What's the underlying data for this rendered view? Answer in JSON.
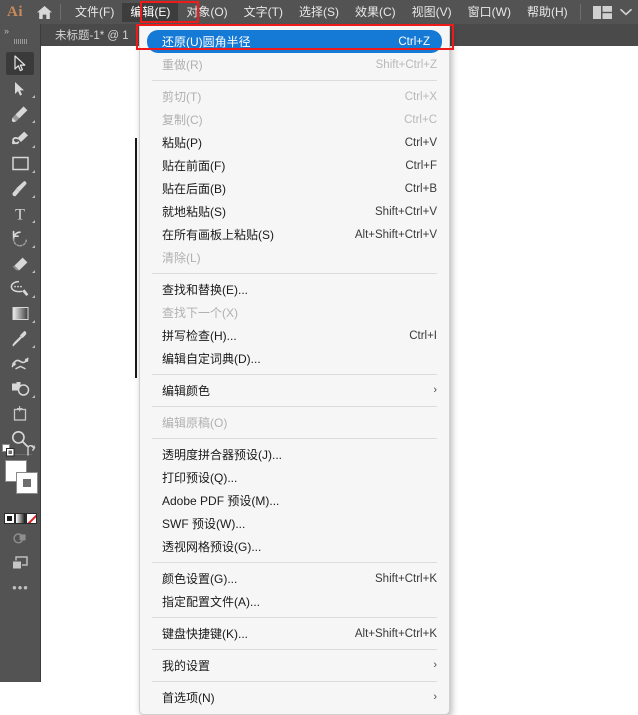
{
  "app": {
    "logo_text": "Ai",
    "home_icon": "home-icon"
  },
  "menubar": {
    "items": [
      {
        "label": "文件(F)",
        "name": "file",
        "active": false
      },
      {
        "label": "编辑(E)",
        "name": "edit",
        "active": true
      },
      {
        "label": "对象(O)",
        "name": "object",
        "active": false
      },
      {
        "label": "文字(T)",
        "name": "type",
        "active": false
      },
      {
        "label": "选择(S)",
        "name": "select",
        "active": false
      },
      {
        "label": "效果(C)",
        "name": "effect",
        "active": false
      },
      {
        "label": "视图(V)",
        "name": "view",
        "active": false
      },
      {
        "label": "窗口(W)",
        "name": "window",
        "active": false
      },
      {
        "label": "帮助(H)",
        "name": "help",
        "active": false
      }
    ],
    "workspace_icon": "workspace-switcher-icon",
    "chevron_icon": "chevron-down-icon"
  },
  "document_tab": {
    "title": "未标题-1* @ 1"
  },
  "toolbar": {
    "grip_label": "»",
    "tools": [
      {
        "name": "selection-tool",
        "selected": true,
        "corner": false
      },
      {
        "name": "direct-selection-tool",
        "selected": false,
        "corner": true
      },
      {
        "name": "pen-tool",
        "selected": false,
        "corner": true
      },
      {
        "name": "curvature-tool",
        "selected": false,
        "corner": true
      },
      {
        "name": "rectangle-tool",
        "selected": false,
        "corner": true
      },
      {
        "name": "paintbrush-tool",
        "selected": false,
        "corner": true
      },
      {
        "name": "type-tool",
        "selected": false,
        "corner": true
      },
      {
        "name": "rotate-tool",
        "selected": false,
        "corner": true
      },
      {
        "name": "eraser-tool",
        "selected": false,
        "corner": true
      },
      {
        "name": "shaper-tool",
        "selected": false,
        "corner": true
      },
      {
        "name": "gradient-tool",
        "selected": false,
        "corner": true
      },
      {
        "name": "eyedropper-tool",
        "selected": false,
        "corner": true
      },
      {
        "name": "blend-tool",
        "selected": false,
        "corner": false
      },
      {
        "name": "shape-builder-tool",
        "selected": false,
        "corner": true
      },
      {
        "name": "artboard-tool",
        "selected": false,
        "corner": false
      },
      {
        "name": "zoom-tool",
        "selected": false,
        "corner": true
      }
    ],
    "fill_color": "#ffffff",
    "stroke_color": "#ffffff",
    "color_modes": [
      "color-mode",
      "gradient-mode",
      "none-mode"
    ],
    "draw_mode_icon": "draw-normal-icon",
    "screen_mode_icon": "screen-mode-icon",
    "more_tools_label": "•••"
  },
  "edit_menu": {
    "items": [
      {
        "type": "item",
        "label": "还原(U)圆角半径",
        "accel": "Ctrl+Z",
        "state": "highlight",
        "name": "undo"
      },
      {
        "type": "item",
        "label": "重做(R)",
        "accel": "Shift+Ctrl+Z",
        "state": "disabled",
        "name": "redo"
      },
      {
        "type": "sep"
      },
      {
        "type": "item",
        "label": "剪切(T)",
        "accel": "Ctrl+X",
        "state": "disabled",
        "name": "cut"
      },
      {
        "type": "item",
        "label": "复制(C)",
        "accel": "Ctrl+C",
        "state": "disabled",
        "name": "copy"
      },
      {
        "type": "item",
        "label": "粘贴(P)",
        "accel": "Ctrl+V",
        "state": "normal",
        "name": "paste"
      },
      {
        "type": "item",
        "label": "贴在前面(F)",
        "accel": "Ctrl+F",
        "state": "normal",
        "name": "paste-in-front"
      },
      {
        "type": "item",
        "label": "贴在后面(B)",
        "accel": "Ctrl+B",
        "state": "normal",
        "name": "paste-in-back"
      },
      {
        "type": "item",
        "label": "就地粘贴(S)",
        "accel": "Shift+Ctrl+V",
        "state": "normal",
        "name": "paste-in-place"
      },
      {
        "type": "item",
        "label": "在所有画板上粘贴(S)",
        "accel": "Alt+Shift+Ctrl+V",
        "state": "normal",
        "name": "paste-on-all-artboards"
      },
      {
        "type": "item",
        "label": "清除(L)",
        "accel": "",
        "state": "disabled",
        "name": "clear"
      },
      {
        "type": "sep"
      },
      {
        "type": "item",
        "label": "查找和替换(E)...",
        "accel": "",
        "state": "normal",
        "name": "find-and-replace"
      },
      {
        "type": "item",
        "label": "查找下一个(X)",
        "accel": "",
        "state": "disabled",
        "name": "find-next"
      },
      {
        "type": "item",
        "label": "拼写检查(H)...",
        "accel": "Ctrl+I",
        "state": "normal",
        "name": "check-spelling"
      },
      {
        "type": "item",
        "label": "编辑自定词典(D)...",
        "accel": "",
        "state": "normal",
        "name": "edit-custom-dictionary"
      },
      {
        "type": "sep"
      },
      {
        "type": "item",
        "label": "编辑颜色",
        "accel": "",
        "state": "submenu",
        "name": "edit-colors"
      },
      {
        "type": "sep"
      },
      {
        "type": "item",
        "label": "编辑原稿(O)",
        "accel": "",
        "state": "disabled",
        "name": "edit-original"
      },
      {
        "type": "sep"
      },
      {
        "type": "item",
        "label": "透明度拼合器预设(J)...",
        "accel": "",
        "state": "normal",
        "name": "transparency-flattener-presets"
      },
      {
        "type": "item",
        "label": "打印预设(Q)...",
        "accel": "",
        "state": "normal",
        "name": "print-presets"
      },
      {
        "type": "item",
        "label": "Adobe PDF 预设(M)...",
        "accel": "",
        "state": "normal",
        "name": "adobe-pdf-presets"
      },
      {
        "type": "item",
        "label": "SWF 预设(W)...",
        "accel": "",
        "state": "normal",
        "name": "swf-presets"
      },
      {
        "type": "item",
        "label": "透视网格预设(G)...",
        "accel": "",
        "state": "normal",
        "name": "perspective-grid-presets"
      },
      {
        "type": "sep"
      },
      {
        "type": "item",
        "label": "颜色设置(G)...",
        "accel": "Shift+Ctrl+K",
        "state": "normal",
        "name": "color-settings"
      },
      {
        "type": "item",
        "label": "指定配置文件(A)...",
        "accel": "",
        "state": "normal",
        "name": "assign-profile"
      },
      {
        "type": "sep"
      },
      {
        "type": "item",
        "label": "键盘快捷键(K)...",
        "accel": "Alt+Shift+Ctrl+K",
        "state": "normal",
        "name": "keyboard-shortcuts"
      },
      {
        "type": "sep"
      },
      {
        "type": "item",
        "label": "我的设置",
        "accel": "",
        "state": "submenu",
        "name": "my-settings"
      },
      {
        "type": "sep"
      },
      {
        "type": "item",
        "label": "首选项(N)",
        "accel": "",
        "state": "submenu",
        "name": "preferences"
      }
    ],
    "submenu_arrow": "›"
  },
  "annotations": {
    "highlight_color": "#ef1a1a",
    "boxes": [
      {
        "name": "redbox-menu",
        "target": "edit-menu-title"
      },
      {
        "name": "redbox-item",
        "target": "undo-menu-item"
      }
    ]
  },
  "colors": {
    "menubar_bg": "#535353",
    "panel_bg": "#f6f6f6",
    "accent_blue": "#147ad6",
    "logo_orange": "#c98a5b"
  }
}
